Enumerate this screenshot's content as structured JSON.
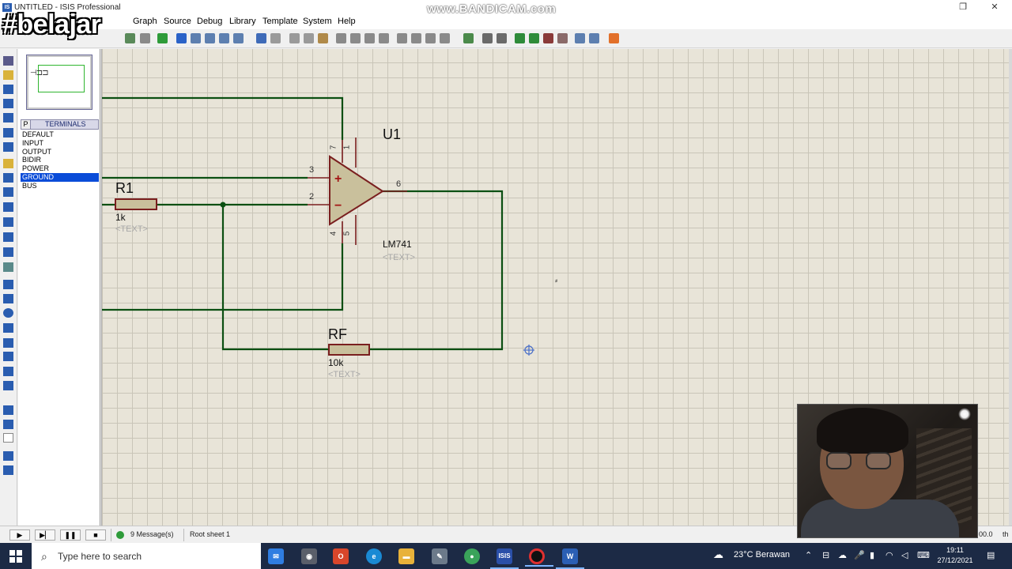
{
  "window": {
    "title": "UNTITLED - ISIS Professional",
    "watermark": "www.BANDICAM.com",
    "overlay_tag": "#belajar",
    "restore_glyph": "❐",
    "close_glyph": "✕"
  },
  "menu": [
    "Graph",
    "Source",
    "Debug",
    "Library",
    "Template",
    "System",
    "Help"
  ],
  "side_panel": {
    "mode_button": "P",
    "header": "TERMINALS",
    "items": [
      "DEFAULT",
      "INPUT",
      "OUTPUT",
      "BIDIR",
      "POWER",
      "GROUND",
      "BUS"
    ],
    "selected": "GROUND"
  },
  "schematic": {
    "opamp": {
      "ref": "U1",
      "value": "LM741",
      "text_placeholder": "<TEXT>",
      "pins": {
        "non_inverting": "3",
        "inverting": "2",
        "output": "6",
        "top_left": "7",
        "top_right": "1",
        "bottom_left": "4",
        "bottom_right": "5"
      },
      "plus_sign": "+",
      "minus_sign": "−"
    },
    "r1": {
      "ref": "R1",
      "value": "1k",
      "text_placeholder": "<TEXT>"
    },
    "rf": {
      "ref": "RF",
      "value": "10k",
      "text_placeholder": "<TEXT>"
    },
    "wire_color": "#0b4f12",
    "component_color": "#7a1f1f"
  },
  "status": {
    "messages": "9 Message(s)",
    "sheet": "Root sheet 1",
    "zoom_right": "00.0",
    "units_right": "th",
    "controls": [
      "▶",
      "▶▏",
      "❚❚",
      "■"
    ]
  },
  "taskbar": {
    "search_placeholder": "Type here to search",
    "weather": "23°C Berawan",
    "time": "19:11",
    "date": "27/12/2021",
    "isis_label": "ISIS",
    "word_label": "W"
  }
}
